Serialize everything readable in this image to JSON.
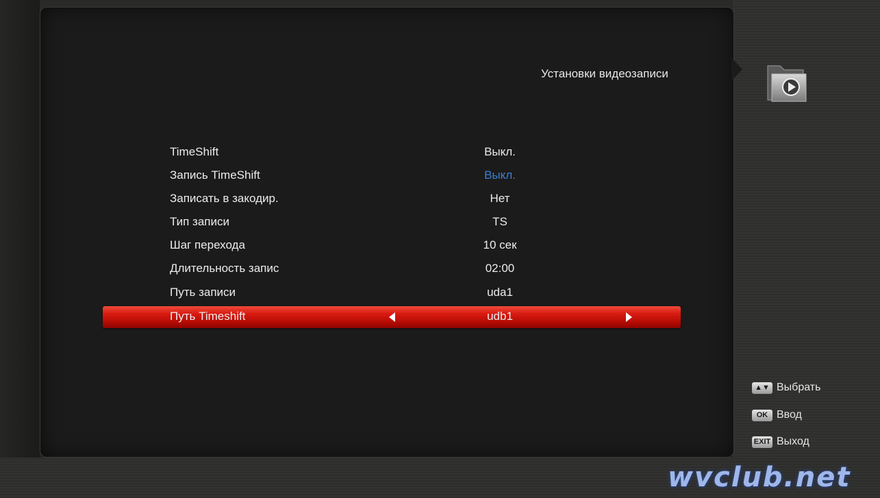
{
  "page": {
    "title": "Установки видеозаписи",
    "icon": "folder-play-icon"
  },
  "settings": [
    {
      "label": "TimeShift",
      "value": "Выкл."
    },
    {
      "label": "Запись TimeShift",
      "value": "Выкл."
    },
    {
      "label": "Записать в закодир.",
      "value": "Нет"
    },
    {
      "label": "Тип записи",
      "value": "TS"
    },
    {
      "label": "Шаг перехода",
      "value": "10 сек"
    },
    {
      "label": "Длительность запис",
      "value": "02:00"
    },
    {
      "label": "Путь записи",
      "value": "uda1"
    },
    {
      "label": "Путь Timeshift",
      "value": "udb1",
      "selected": true
    }
  ],
  "help": [
    {
      "key": "▲▼",
      "text": "Выбрать"
    },
    {
      "key": "OK",
      "text": "Ввод"
    },
    {
      "key": "EXIT",
      "text": "Выход"
    }
  ],
  "watermark": "wvclub.net",
  "colors": {
    "highlight": "#d71a10",
    "value_highlight": "#3d7fd0",
    "text": "#ececec"
  }
}
